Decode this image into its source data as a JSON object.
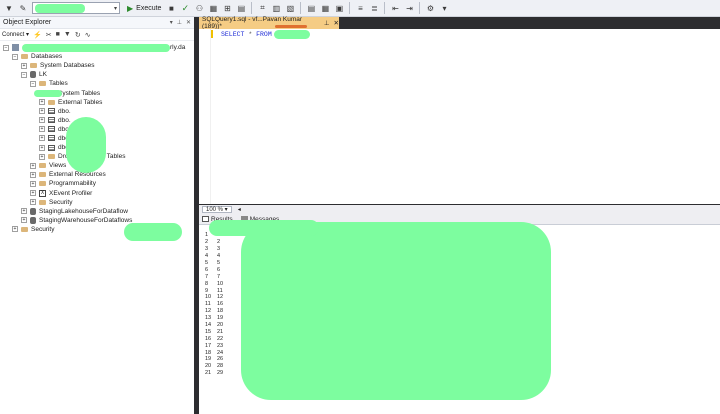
{
  "toolbar": {
    "execute_label": "Execute"
  },
  "object_explorer": {
    "title": "Object Explorer",
    "connect_label": "Connect",
    "server_suffix": "rly.da",
    "tree": [
      {
        "label": "Databases",
        "indent": 1,
        "exp": "-",
        "icon": "folder"
      },
      {
        "label": "System Databases",
        "indent": 2,
        "exp": "+",
        "icon": "folder"
      },
      {
        "label": "LK",
        "indent": 2,
        "exp": "-",
        "icon": "db"
      },
      {
        "label": "Tables",
        "indent": 3,
        "exp": "-",
        "icon": "folder"
      },
      {
        "label": "System Tables",
        "indent": 4,
        "exp": "+",
        "icon": "folder"
      },
      {
        "label": "External Tables",
        "indent": 4,
        "exp": "+",
        "icon": "folder"
      },
      {
        "label": "dbo.",
        "indent": 4,
        "exp": "+",
        "icon": "table"
      },
      {
        "label": "dbo.",
        "indent": 4,
        "exp": "+",
        "icon": "table"
      },
      {
        "label": "dbo.",
        "indent": 4,
        "exp": "+",
        "icon": "table"
      },
      {
        "label": "dbo.",
        "indent": 4,
        "exp": "+",
        "icon": "table"
      },
      {
        "label": "dbo.",
        "indent": 4,
        "exp": "+",
        "icon": "table"
      },
      {
        "label": "Dropped Ledger Tables",
        "indent": 4,
        "exp": "+",
        "icon": "folder"
      },
      {
        "label": "Views",
        "indent": 3,
        "exp": "+",
        "icon": "folder"
      },
      {
        "label": "External Resources",
        "indent": 3,
        "exp": "+",
        "icon": "folder"
      },
      {
        "label": "Programmability",
        "indent": 3,
        "exp": "+",
        "icon": "folder"
      },
      {
        "label": "XEvent Profiler",
        "indent": 3,
        "exp": "+",
        "icon": "xevent"
      },
      {
        "label": "Security",
        "indent": 3,
        "exp": "+",
        "icon": "folder"
      },
      {
        "label": "StagingLakehouseForDataflow",
        "indent": 2,
        "exp": "+",
        "icon": "db"
      },
      {
        "label": "StagingWarehouseForDataflows_",
        "indent": 2,
        "exp": "+",
        "icon": "db"
      },
      {
        "label": "Security",
        "indent": 1,
        "exp": "+",
        "icon": "folder"
      }
    ]
  },
  "editor": {
    "tab_label": "SQLQuery1.sql - vf...Pavan Kumar (189))*",
    "code_keyword_select": "SELECT",
    "code_star": "*",
    "code_keyword_from": "FROM"
  },
  "zoom": "100 %",
  "results_tabs": {
    "results": "Results",
    "messages": "Messages"
  },
  "result_rows": [
    {
      "n": "1",
      "v": ""
    },
    {
      "n": "2",
      "v": "2"
    },
    {
      "n": "3",
      "v": "3"
    },
    {
      "n": "4",
      "v": "4"
    },
    {
      "n": "5",
      "v": "5"
    },
    {
      "n": "6",
      "v": "6"
    },
    {
      "n": "7",
      "v": "7"
    },
    {
      "n": "8",
      "v": "10"
    },
    {
      "n": "9",
      "v": "11"
    },
    {
      "n": "10",
      "v": "12"
    },
    {
      "n": "11",
      "v": "16"
    },
    {
      "n": "12",
      "v": "18"
    },
    {
      "n": "13",
      "v": "19"
    },
    {
      "n": "14",
      "v": "20"
    },
    {
      "n": "15",
      "v": "21"
    },
    {
      "n": "16",
      "v": "22"
    },
    {
      "n": "17",
      "v": "23"
    },
    {
      "n": "18",
      "v": "24"
    },
    {
      "n": "19",
      "v": "26"
    },
    {
      "n": "20",
      "v": "28"
    },
    {
      "n": "21",
      "v": "29"
    }
  ]
}
